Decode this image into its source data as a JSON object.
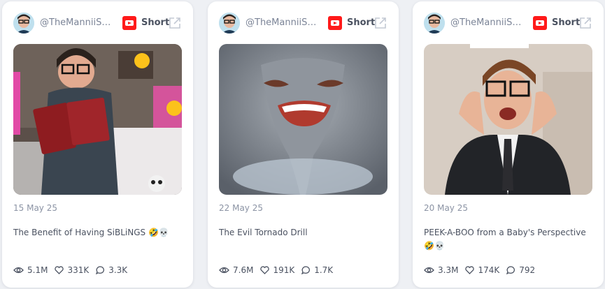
{
  "cards": [
    {
      "channel": "@TheManniiSh…",
      "platform_icon": "youtube-icon",
      "type_label": "Short",
      "date": "15 May 25",
      "title": "The Benefit of Having SiBLiNGS 🤣💀",
      "views": "5.1M",
      "likes": "331K",
      "comments": "3.3K"
    },
    {
      "channel": "@TheManniiSh…",
      "platform_icon": "youtube-icon",
      "type_label": "Short",
      "date": "22 May 25",
      "title": "The Evil Tornado Drill",
      "views": "7.6M",
      "likes": "191K",
      "comments": "1.7K"
    },
    {
      "channel": "@TheManniiSh…",
      "platform_icon": "youtube-icon",
      "type_label": "Short",
      "date": "20 May 25",
      "title": "PEEK-A-BOO from a Baby's Perspective 🤣💀",
      "views": "3.3M",
      "likes": "174K",
      "comments": "792"
    }
  ],
  "colors": {
    "youtube": "#ff1a1a",
    "text_muted": "#8b93a4",
    "text": "#4b5261",
    "background": "#eef0f4"
  }
}
